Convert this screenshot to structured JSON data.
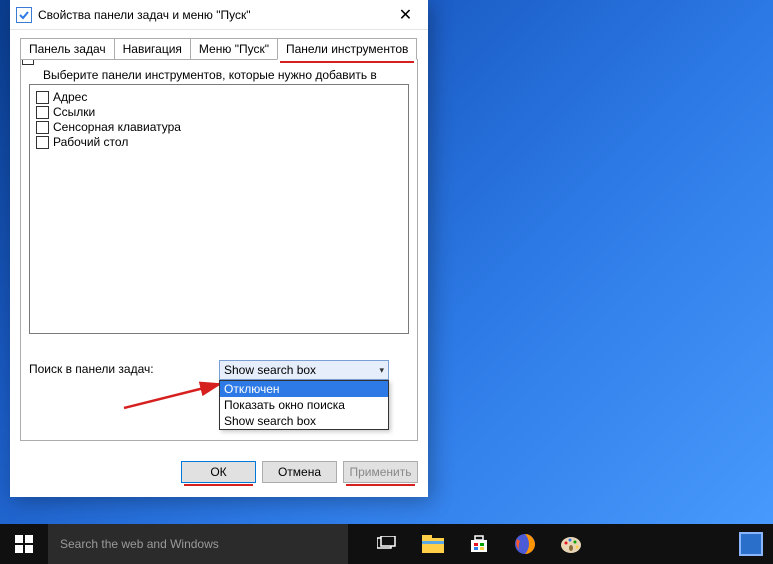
{
  "dialog": {
    "title": "Свойства панели задач и меню \"Пуск\"",
    "tabs": [
      "Панель задач",
      "Навигация",
      "Меню \"Пуск\"",
      "Панели инструментов"
    ],
    "active_tab": 3,
    "instruction": "Выберите панели инструментов, которые нужно добавить в",
    "toolbars": [
      {
        "label": "Адрес",
        "checked": false
      },
      {
        "label": "Ссылки",
        "checked": false
      },
      {
        "label": "Сенсорная клавиатура",
        "checked": false
      },
      {
        "label": "Рабочий стол",
        "checked": false
      }
    ],
    "search_label": "Поиск в панели задач:",
    "combo_selected": "Show search box",
    "combo_options": [
      "Отключен",
      "Показать окно поиска",
      "Show search box"
    ],
    "combo_highlighted": 0,
    "buttons": {
      "ok": "ОК",
      "cancel": "Отмена",
      "apply": "Применить"
    }
  },
  "taskbar": {
    "search_placeholder": "Search the web and Windows"
  }
}
